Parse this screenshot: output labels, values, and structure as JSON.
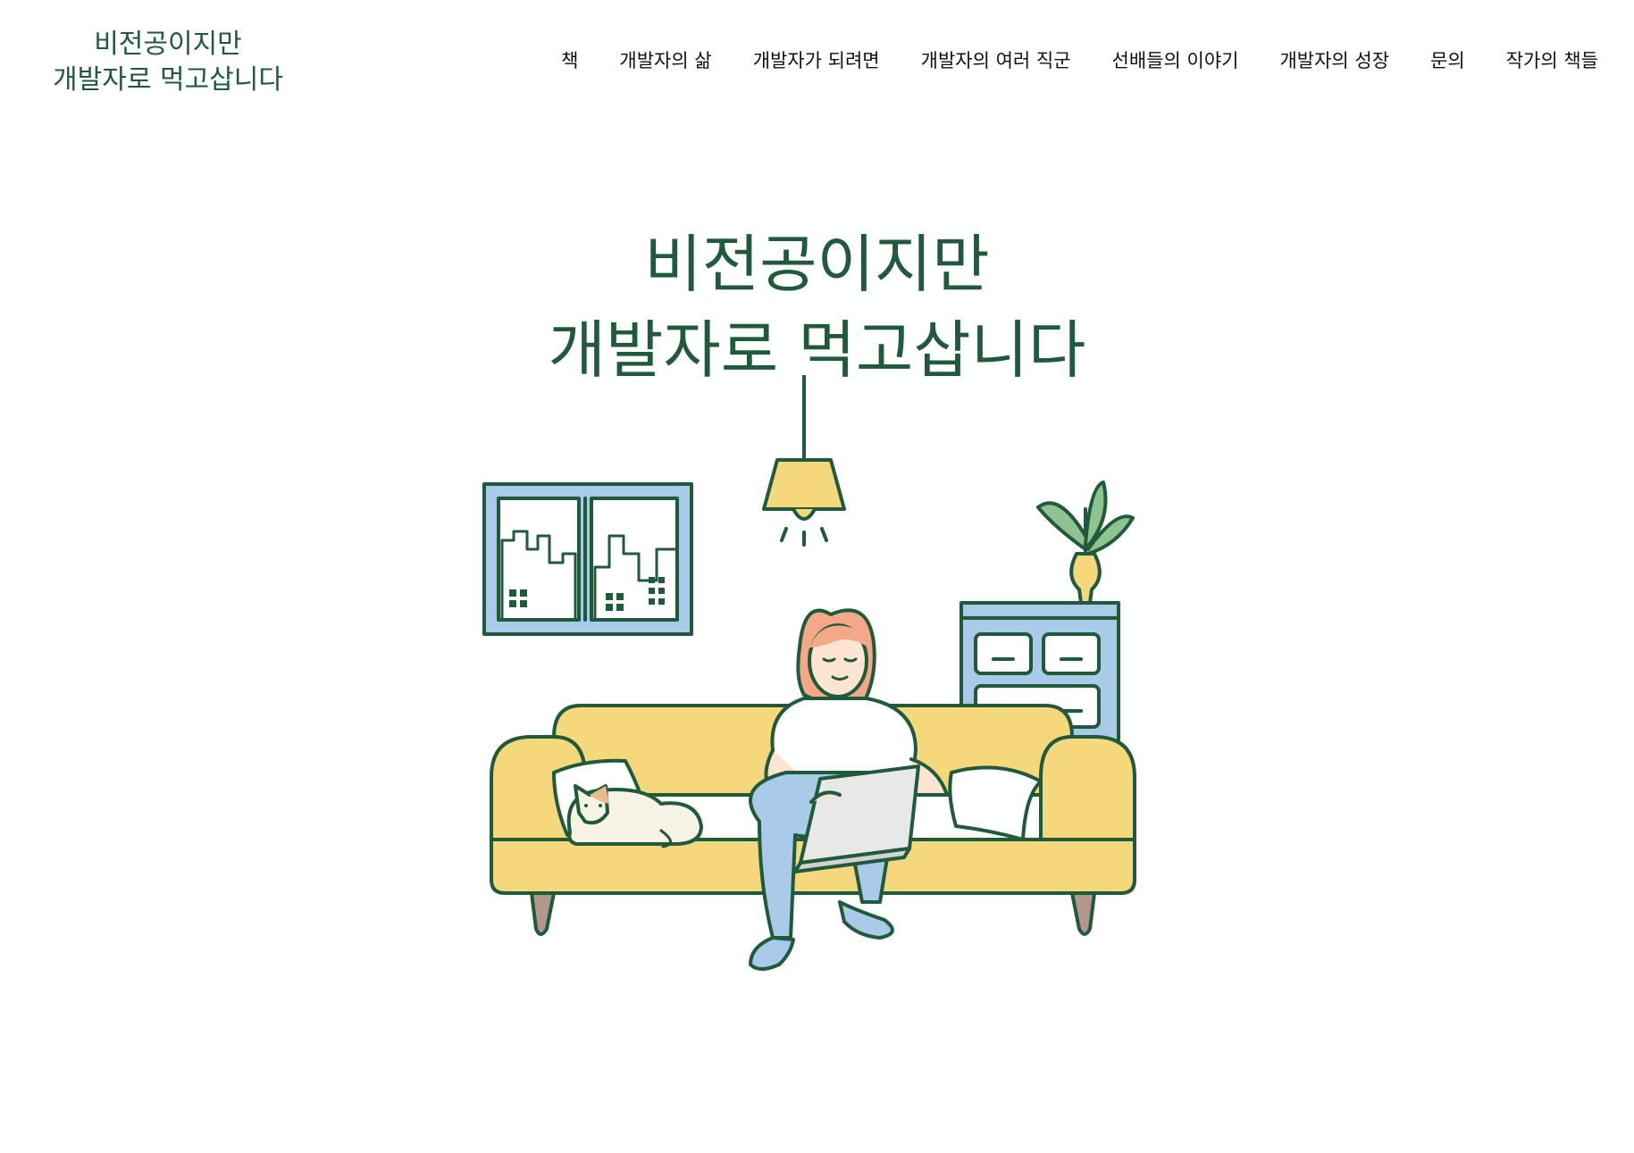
{
  "site": {
    "logo_line1": "비전공이지만",
    "logo_line2": "개발자로 먹고삽니다"
  },
  "nav": {
    "items": [
      {
        "label": "책"
      },
      {
        "label": "개발자의 삶"
      },
      {
        "label": "개발자가 되려면"
      },
      {
        "label": "개발자의 여러 직군"
      },
      {
        "label": "선배들의 이야기"
      },
      {
        "label": "개발자의 성장"
      },
      {
        "label": "문의"
      },
      {
        "label": "작가의 책들"
      }
    ]
  },
  "hero": {
    "title_line1": "비전공이지만",
    "title_line2": "개발자로 먹고삽니다"
  },
  "colors": {
    "brand_green": "#1f5a3a",
    "sofa_yellow": "#f5d77c",
    "window_blue": "#a9cbe9",
    "skin": "#fbe4d2",
    "hair": "#f4a889"
  },
  "icons": [
    "lamp-icon",
    "window-illustration",
    "plant-icon",
    "dresser-illustration",
    "sofa-illustration",
    "cat-illustration",
    "laptop-icon"
  ]
}
